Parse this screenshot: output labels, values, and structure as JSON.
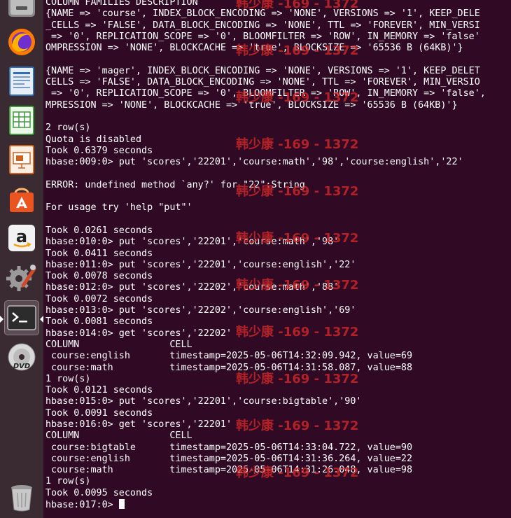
{
  "launcher": {
    "items": [
      {
        "name": "files",
        "icon": "file-manager-icon"
      },
      {
        "name": "firefox",
        "icon": "firefox-icon"
      },
      {
        "name": "writer",
        "icon": "libreoffice-writer-icon"
      },
      {
        "name": "calc",
        "icon": "libreoffice-calc-icon"
      },
      {
        "name": "impress",
        "icon": "libreoffice-impress-icon"
      },
      {
        "name": "software",
        "icon": "software-center-icon"
      },
      {
        "name": "amazon",
        "icon": "amazon-icon"
      },
      {
        "name": "settings",
        "icon": "system-settings-icon"
      },
      {
        "name": "terminal",
        "icon": "terminal-icon",
        "active": true
      },
      {
        "name": "dvd",
        "icon": "dvd-icon"
      },
      {
        "name": "trash",
        "icon": "trash-icon"
      }
    ],
    "amazon_glyph": "a",
    "dvd_label": "DVD"
  },
  "terminal": {
    "lines": [
      "COLUMN FAMILIES DESCRIPTION",
      "{NAME => 'course', INDEX_BLOCK_ENCODING => 'NONE', VERSIONS => '1', KEEP_DELE",
      "_CELLS => 'FALSE', DATA_BLOCK_ENCODING => 'NONE', TTL => 'FOREVER', MIN_VERSI",
      " => '0', REPLICATION_SCOPE => '0', BLOOMFILTER => 'ROW', IN_MEMORY => 'false'",
      "OMPRESSION => 'NONE', BLOCKCACHE => 'true', BLOCKSIZE => '65536 B (64KB)'}",
      "",
      "{NAME => 'mager', INDEX_BLOCK_ENCODING => 'NONE', VERSIONS => '1', KEEP_DELET",
      "CELLS => 'FALSE', DATA_BLOCK_ENCODING => 'NONE', TTL => 'FOREVER', MIN_VERSIO",
      " => '0', REPLICATION_SCOPE => '0', BLOOMFILTER => 'ROW', IN_MEMORY => 'false',",
      "MPRESSION => 'NONE', BLOCKCACHE => 'true', BLOCKSIZE => '65536 B (64KB)'}",
      "",
      "2 row(s)",
      "Quota is disabled",
      "Took 0.6379 seconds",
      "hbase:009:0> put 'scores','22201','course:math','98','course:english','22'",
      "",
      "ERROR: undefined method `any?' for \"22\":String",
      "",
      "For usage try 'help \"put\"'",
      "",
      "Took 0.0261 seconds",
      "hbase:010:0> put 'scores','22201','course:math','98'",
      "Took 0.0411 seconds",
      "hbase:011:0> put 'scores','22201','course:english','22'",
      "Took 0.0078 seconds",
      "hbase:012:0> put 'scores','22202','course:math','88'",
      "Took 0.0072 seconds",
      "hbase:013:0> put 'scores','22202','course:english','69'",
      "Took 0.0081 seconds",
      "hbase:014:0> get 'scores','22202'",
      "COLUMN                CELL",
      " course:english       timestamp=2025-05-06T14:32:09.942, value=69",
      " course:math          timestamp=2025-05-06T14:31:58.087, value=88",
      "1 row(s)",
      "Took 0.0121 seconds",
      "hbase:015:0> put 'scores','22201','course:bigtable','90'",
      "Took 0.0091 seconds",
      "hbase:016:0> get 'scores','22201'",
      "COLUMN                CELL",
      " course:bigtable      timestamp=2025-05-06T14:33:04.722, value=90",
      " course:english       timestamp=2025-05-06T14:31:36.264, value=22",
      " course:math          timestamp=2025-05-06T14:31:26.048, value=98",
      "1 row(s)",
      "Took 0.0095 seconds"
    ],
    "prompt": "hbase:017:0> "
  },
  "watermark": {
    "text": "韩少康 -169 - 1372",
    "color": "#d62828"
  },
  "colors": {
    "terminal_bg": "#300a24",
    "terminal_fg": "#ffffff",
    "launcher_bg": "#3a2a31"
  }
}
